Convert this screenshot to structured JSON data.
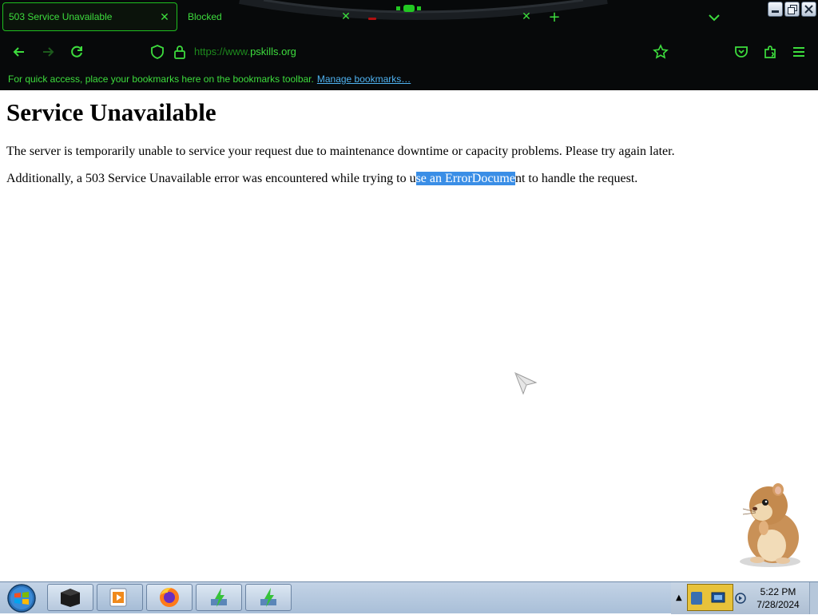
{
  "browser": {
    "tabs": [
      {
        "label": "503 Service Unavailable",
        "active": true
      },
      {
        "label": "Blocked",
        "active": false
      },
      {
        "label": "",
        "active": false
      }
    ],
    "url": {
      "prefix": "https://www.",
      "host": "pskills.org"
    },
    "bookmarks_bar": {
      "text": "For quick access, place your bookmarks here on the bookmarks toolbar.",
      "link": "Manage bookmarks…"
    },
    "accent_color": "#3ddc3d"
  },
  "page": {
    "heading": "Service Unavailable",
    "paragraph1": "The server is temporarily unable to service your request due to maintenance downtime or capacity problems. Please try again later.",
    "paragraph2": {
      "before": "Additionally, a 503 Service Unavailable error was encountered while trying to u",
      "selected": "se an ErrorDocume",
      "after": "nt to handle the request."
    }
  },
  "taskbar": {
    "clock": {
      "time": "5:22 PM",
      "date": "7/28/2024"
    },
    "pinned": [
      "terminal-icon",
      "media-player-icon",
      "firefox-icon",
      "green-app-icon",
      "green-app-icon"
    ]
  }
}
